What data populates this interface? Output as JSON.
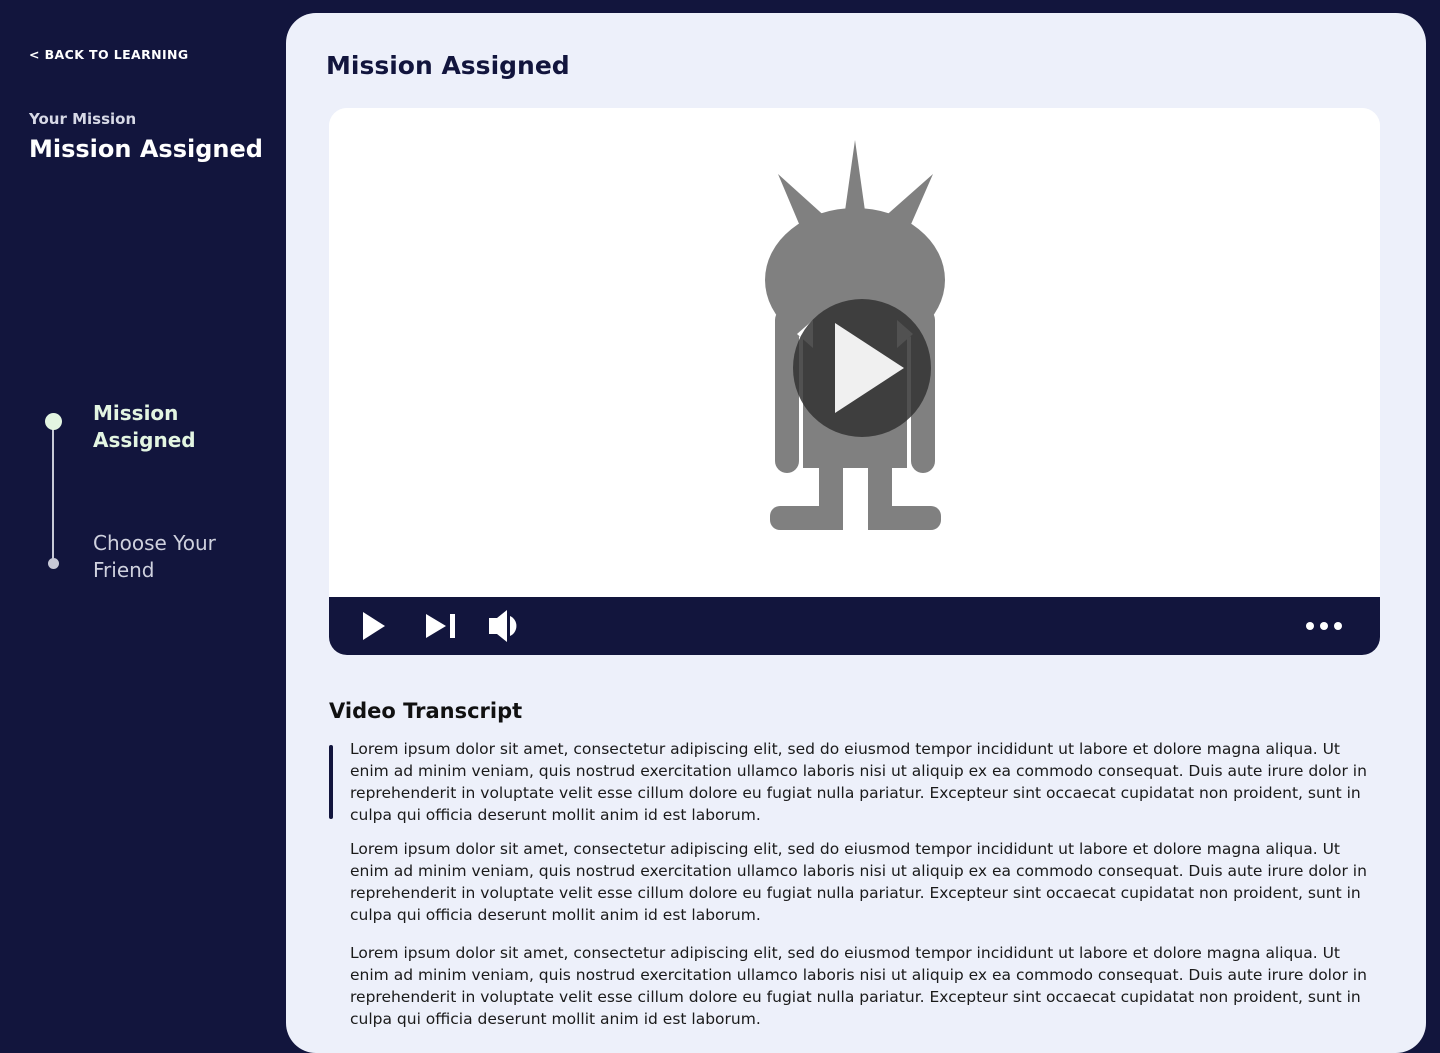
{
  "sidebar": {
    "back_label": "< BACK TO LEARNING",
    "kicker": "Your Mission",
    "title": "Mission Assigned",
    "steps": [
      {
        "label": "Mission Assigned",
        "state": "active"
      },
      {
        "label": "Choose Your Friend",
        "state": "upcoming"
      }
    ]
  },
  "main": {
    "title": "Mission Assigned",
    "video": {
      "controls": [
        "play-icon",
        "skip-next-icon",
        "volume-icon",
        "more-icon"
      ]
    },
    "transcript": {
      "title": "Video Transcript",
      "paragraphs": [
        "Lorem ipsum dolor sit amet, consectetur adipiscing elit, sed do eiusmod tempor incididunt ut labore et dolore magna aliqua. Ut enim ad minim veniam, quis nostrud exercitation ullamco laboris nisi ut aliquip ex ea commodo consequat. Duis aute irure dolor in reprehenderit in voluptate velit esse cillum dolore eu fugiat nulla pariatur. Excepteur sint occaecat cupidatat non proident, sunt in culpa qui officia deserunt mollit anim id est laborum.",
        "Lorem ipsum dolor sit amet, consectetur adipiscing elit, sed do eiusmod tempor incididunt ut labore et dolore magna aliqua. Ut enim ad minim veniam, quis nostrud exercitation ullamco laboris nisi ut aliquip ex ea commodo consequat. Duis aute irure dolor in reprehenderit in voluptate velit esse cillum dolore eu fugiat nulla pariatur. Excepteur sint occaecat cupidatat non proident, sunt in culpa qui officia deserunt mollit anim id est laborum.",
        "Lorem ipsum dolor sit amet, consectetur adipiscing elit, sed do eiusmod tempor incididunt ut labore et dolore magna aliqua. Ut enim ad minim veniam, quis nostrud exercitation ullamco laboris nisi ut aliquip ex ea commodo consequat. Duis aute irure dolor in reprehenderit in voluptate velit esse cillum dolore eu fugiat nulla pariatur. Excepteur sint occaecat cupidatat non proident, sunt in culpa qui officia deserunt mollit anim id est laborum."
      ]
    }
  },
  "colors": {
    "sidebar_bg": "#12153d",
    "panel_bg": "#edf0fa",
    "active_step": "#e3f5e2",
    "video_controls_bg": "#12153d"
  }
}
